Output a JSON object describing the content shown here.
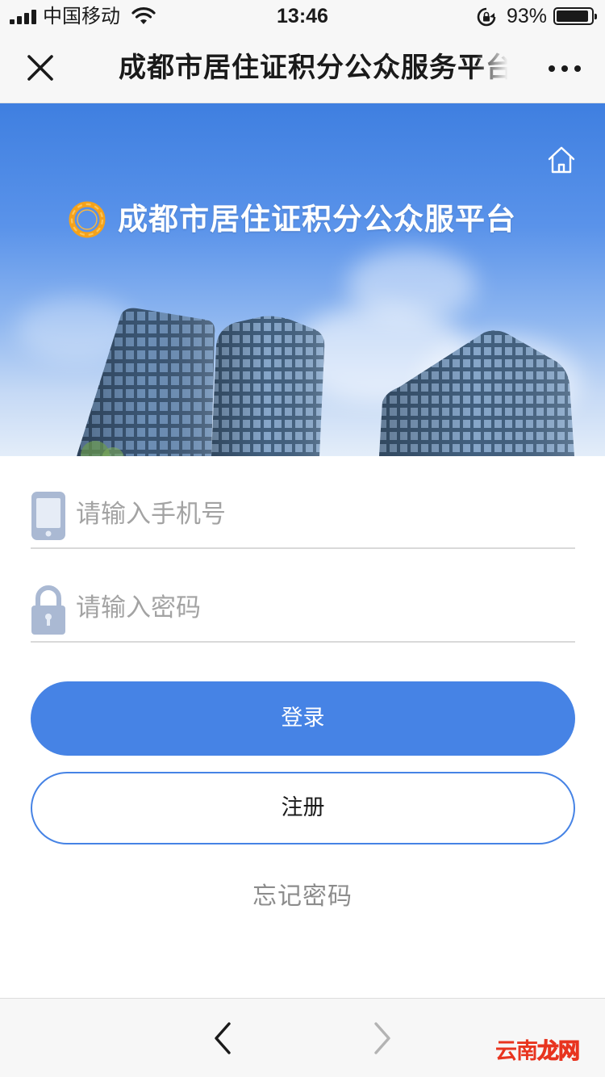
{
  "status_bar": {
    "carrier": "中国移动",
    "time": "13:46",
    "battery_percent": "93%",
    "battery_level": 0.93
  },
  "nav": {
    "title": "成都市居住证积分公众服务平台"
  },
  "banner": {
    "title": "成都市居住证积分公众服平台"
  },
  "form": {
    "phone_placeholder": "请输入手机号",
    "password_placeholder": "请输入密码",
    "login_label": "登录",
    "register_label": "注册",
    "forgot_label": "忘记密码"
  },
  "watermark": {
    "text_a": "云南",
    "text_b": "龙网"
  },
  "colors": {
    "primary": "#4683e5",
    "logo_orange": "#f5a21b",
    "watermark_red": "#e8341f"
  },
  "icons": [
    "signal-icon",
    "wifi-icon",
    "rotation-lock-icon",
    "battery-icon",
    "close-icon",
    "more-icon",
    "home-icon",
    "logo-icon",
    "phone-icon",
    "lock-icon",
    "back-icon",
    "forward-icon"
  ]
}
